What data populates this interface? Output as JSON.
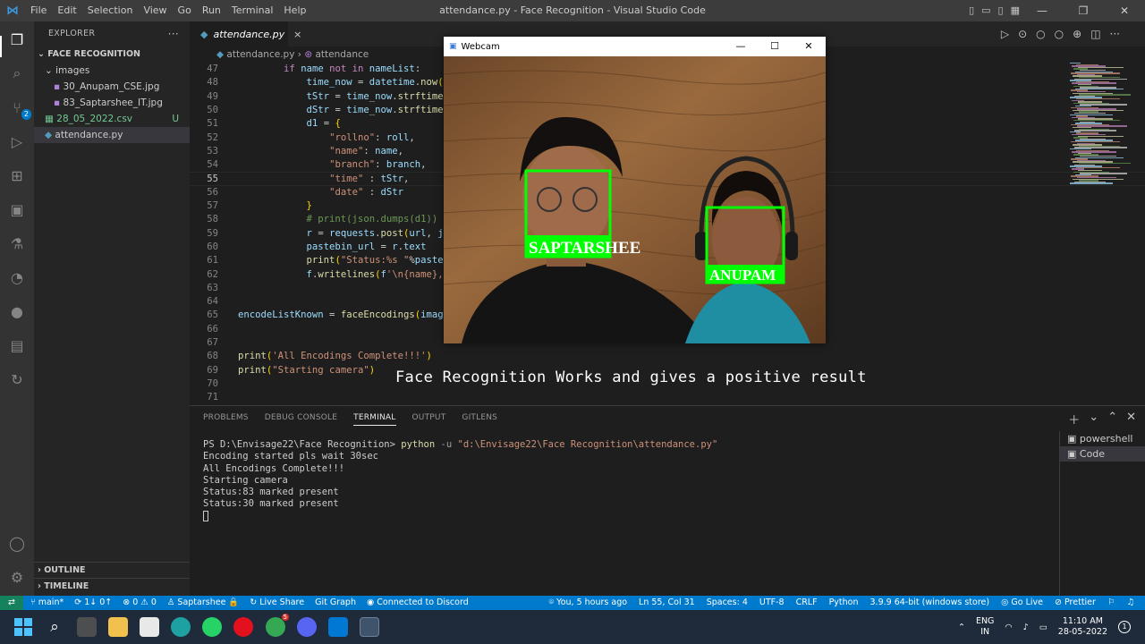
{
  "window": {
    "title": "attendance.py - Face Recognition - Visual Studio Code"
  },
  "menu": [
    "File",
    "Edit",
    "Selection",
    "View",
    "Go",
    "Run",
    "Terminal",
    "Help"
  ],
  "activity": {
    "scm_badge": "2"
  },
  "explorer": {
    "header": "EXPLORER",
    "folder": "FACE RECOGNITION",
    "items": [
      {
        "label": "images"
      },
      {
        "label": "30_Anupam_CSE.jpg"
      },
      {
        "label": "83_Saptarshee_IT.jpg"
      },
      {
        "label": "28_05_2022.csv",
        "status": "U"
      },
      {
        "label": "attendance.py"
      }
    ],
    "outline": "OUTLINE",
    "timeline": "TIMELINE"
  },
  "tab": {
    "label": "attendance.py",
    "close": "×"
  },
  "breadcrumb": {
    "file": "attendance.py",
    "symbol": "attendance"
  },
  "code": [
    {
      "n": "47",
      "t": "        if name not in nameList:"
    },
    {
      "n": "48",
      "t": "            time_now = datetime.now()"
    },
    {
      "n": "49",
      "t": "            tStr = time_now.strftime("
    },
    {
      "n": "50",
      "t": "            dStr = time_now.strftime("
    },
    {
      "n": "51",
      "t": "            d1 = {"
    },
    {
      "n": "52",
      "t": "                \"rollno\": roll,"
    },
    {
      "n": "53",
      "t": "                \"name\": name,"
    },
    {
      "n": "54",
      "t": "                \"branch\": branch,"
    },
    {
      "n": "55",
      "t": "                \"time\" : tStr,"
    },
    {
      "n": "56",
      "t": "                \"date\" : dStr"
    },
    {
      "n": "57",
      "t": "            }"
    },
    {
      "n": "58",
      "t": "            # print(json.dumps(d1))"
    },
    {
      "n": "59",
      "t": "            r = requests.post(url, jso"
    },
    {
      "n": "60",
      "t": "            pastebin_url = r.text"
    },
    {
      "n": "61",
      "t": "            print(\"Status:%s \"%pasteb"
    },
    {
      "n": "62",
      "t": "            f.writelines(f'\\n{name}, "
    },
    {
      "n": "63",
      "t": ""
    },
    {
      "n": "64",
      "t": ""
    },
    {
      "n": "65",
      "t": "encodeListKnown = faceEncodings(images"
    },
    {
      "n": "66",
      "t": ""
    },
    {
      "n": "67",
      "t": ""
    },
    {
      "n": "68",
      "t": "print('All Encodings Complete!!!')"
    },
    {
      "n": "69",
      "t": "print(\"Starting camera\")"
    },
    {
      "n": "70",
      "t": ""
    },
    {
      "n": "71",
      "t": ""
    }
  ],
  "caption": "Face Recognition Works and gives a positive result",
  "webcam": {
    "title": "Webcam",
    "faces": [
      {
        "label": "SAPTARSHEE"
      },
      {
        "label": "ANUPAM"
      }
    ]
  },
  "panel": {
    "tabs": [
      "PROBLEMS",
      "DEBUG CONSOLE",
      "TERMINAL",
      "OUTPUT",
      "GITLENS"
    ],
    "active_tab": "TERMINAL",
    "terminal": {
      "prompt": "PS D:\\Envisage22\\Face Recognition> ",
      "cmd": "python",
      "flag": " -u ",
      "path": "\"d:\\Envisage22\\Face Recognition\\attendance.py\"",
      "lines": [
        "Encoding started pls wait 30sec",
        "All Encodings Complete!!!",
        "Starting camera",
        "Status:83 marked present",
        "Status:30 marked present"
      ]
    },
    "terminals": [
      "powershell",
      "Code"
    ]
  },
  "statusbar": {
    "left": [
      "main*",
      "1↓ 0↑",
      "⊗ 0 ⚠ 0",
      "Saptarshee 🔒",
      "Live Share",
      "Git Graph",
      "Connected to Discord"
    ],
    "right": [
      "You, 5 hours ago",
      "Ln 55, Col 31",
      "Spaces: 4",
      "UTF-8",
      "CRLF",
      "Python",
      "3.9.9 64-bit (windows store)",
      "Go Live",
      "Prettier"
    ]
  },
  "tray": {
    "lang1": "ENG",
    "lang2": "IN",
    "time": "11:10 AM",
    "date": "28-05-2022",
    "notif": "1",
    "browser_badge": "5"
  },
  "colors": {
    "accent": "#007acc",
    "face_box": "#00ff00",
    "remote": "#16825d"
  }
}
